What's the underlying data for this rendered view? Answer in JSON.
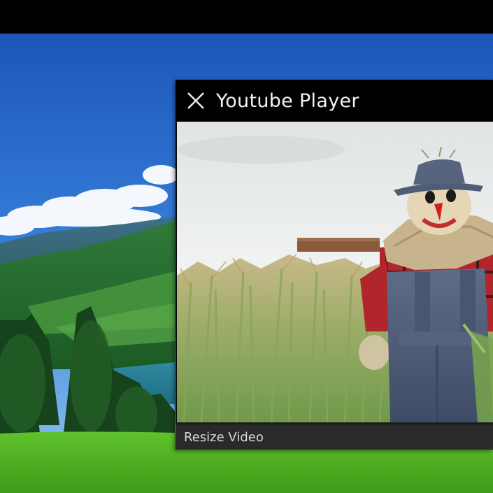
{
  "player": {
    "title": "Youtube Player",
    "close_icon": "close-icon",
    "footer": {
      "resize_label": "Resize Video"
    }
  },
  "colors": {
    "titlebar": "#000000",
    "title_text": "#f2f2f2",
    "footer": "#2a2a2a",
    "footer_text": "#d8d8d8"
  }
}
